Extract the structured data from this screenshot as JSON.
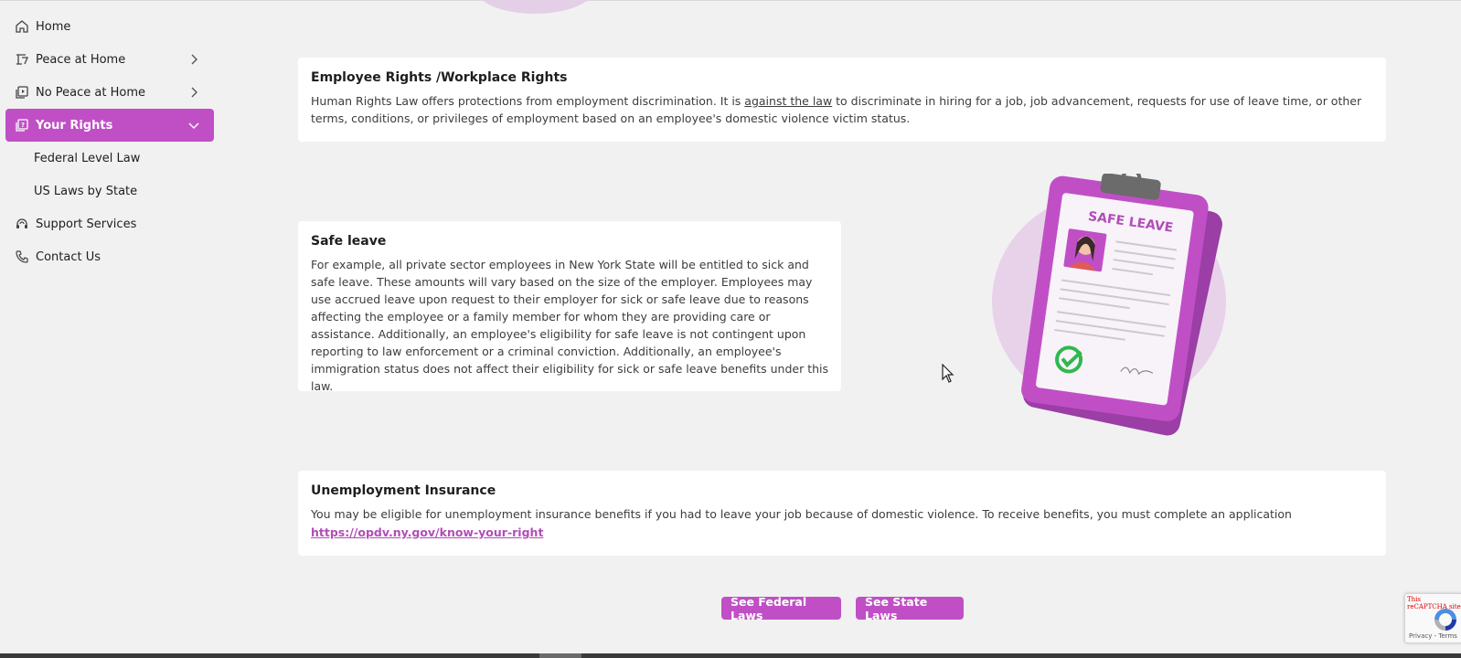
{
  "sidebar": {
    "items": [
      {
        "label": "Home",
        "icon": "home-icon"
      },
      {
        "label": "Peace at Home",
        "icon": "peace-icon"
      },
      {
        "label": "No Peace at Home",
        "icon": "media-icon"
      },
      {
        "label": "Your Rights",
        "icon": "rights-icon"
      },
      {
        "label": "Federal Level Law"
      },
      {
        "label": "US Laws by State"
      },
      {
        "label": "Support Services",
        "icon": "headset-icon"
      },
      {
        "label": "Contact Us",
        "icon": "phone-icon"
      }
    ]
  },
  "sections": {
    "employee": {
      "title": "Employee Rights /Workplace Rights",
      "text_before": "Human Rights Law offers protections from employment discrimination. It is ",
      "link": "against the law",
      "text_after": " to discriminate in hiring for a job, job advancement, requests for use of leave time, or other terms, conditions, or privileges of employment based on an employee's domestic violence victim status."
    },
    "safe_leave": {
      "title": "Safe leave",
      "text": "For example, all private sector employees in New York State will be entitled to sick and safe leave. These amounts will vary based on the size of the employer. Employees may use accrued leave upon request to their employer for sick or safe leave due to reasons affecting the employee or a family member for whom they are providing care or assistance. Additionally, an employee's eligibility for safe leave is not contingent upon reporting to law enforcement or a criminal conviction. Additionally, an employee's immigration status does not affect their eligibility for sick or safe leave benefits under this law.",
      "illustration_label": "SAFE LEAVE"
    },
    "unemployment": {
      "title": "Unemployment Insurance",
      "text": "You may be eligible for unemployment insurance benefits if you had to leave your job because of domestic violence. To receive benefits, you must complete an application",
      "link": "https://opdv.ny.gov/know-your-right"
    }
  },
  "buttons": {
    "federal": "See Federal Laws",
    "state": "See State Laws"
  },
  "recaptcha": {
    "error": "This reCAPTCHA site ... you a",
    "terms": "Privacy - Terms"
  },
  "colors": {
    "accent": "#c04fc6",
    "background": "#f1f1f1"
  }
}
